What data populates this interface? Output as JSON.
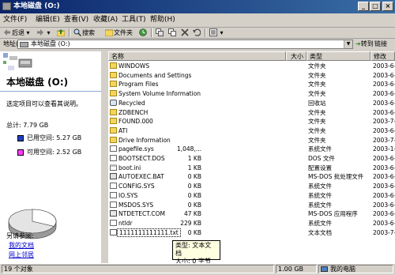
{
  "window": {
    "title": "本地磁盘 (O:)",
    "min": "_",
    "max": "□",
    "close": "×"
  },
  "menu": [
    "文件(F)",
    "编辑(E)",
    "查看(V)",
    "收藏(A)",
    "工具(T)",
    "帮助(H)"
  ],
  "toolbar": {
    "back": "后退",
    "search": "搜索",
    "folders": "文件夹"
  },
  "address": {
    "label": "地址(D)",
    "value": "本地磁盘 (O:)",
    "go": "转到",
    "links": "链接"
  },
  "left": {
    "title": "本地磁盘 (O:)",
    "hint": "选定项目可以查看其说明。",
    "total": "总计: 7.79 GB",
    "used": "已用空间: 5.27 GB",
    "free": "可用空间: 2.52 GB",
    "see_also": "另请参阅:",
    "link1": "我的文档",
    "link2": "网上邻居",
    "used_fraction": 0.68
  },
  "columns": {
    "name": "名称",
    "size": "大小",
    "type": "类型",
    "date": "修改"
  },
  "files": [
    {
      "name": "WINDOWS",
      "size": "",
      "type": "文件夹",
      "date": "2003-6-",
      "icon": "folder-icon"
    },
    {
      "name": "Documents and Settings",
      "size": "",
      "type": "文件夹",
      "date": "2003-6-",
      "icon": "folder-icon"
    },
    {
      "name": "Program Files",
      "size": "",
      "type": "文件夹",
      "date": "2003-6-",
      "icon": "folder-icon"
    },
    {
      "name": "System Volume Information",
      "size": "",
      "type": "文件夹",
      "date": "2003-6-",
      "icon": "folder-icon"
    },
    {
      "name": "Recycled",
      "size": "",
      "type": "回收站",
      "date": "2003-6-",
      "icon": "recycle-icon"
    },
    {
      "name": "ZDBENCH",
      "size": "",
      "type": "文件夹",
      "date": "2003-6-",
      "icon": "folder-icon"
    },
    {
      "name": "FOUND.000",
      "size": "",
      "type": "文件夹",
      "date": "2003-7-",
      "icon": "folder-icon"
    },
    {
      "name": "ATI",
      "size": "",
      "type": "文件夹",
      "date": "2003-6-",
      "icon": "folder-icon"
    },
    {
      "name": "Drive Information",
      "size": "",
      "type": "文件夹",
      "date": "2003-7-",
      "icon": "folder-icon"
    },
    {
      "name": "pagefile.sys",
      "size": "1,048,...",
      "type": "系统文件",
      "date": "2003-1-",
      "icon": "sysfile-icon"
    },
    {
      "name": "BOOTSECT.DOS",
      "size": "1 KB",
      "type": "DOS 文件",
      "date": "2003-6-",
      "icon": "file-icon"
    },
    {
      "name": "boot.ini",
      "size": "1 KB",
      "type": "配置设置",
      "date": "2003-6-",
      "icon": "ini-icon"
    },
    {
      "name": "AUTOEXEC.BAT",
      "size": "0 KB",
      "type": "MS-DOS 批处理文件",
      "date": "2003-6-",
      "icon": "bat-icon"
    },
    {
      "name": "CONFIG.SYS",
      "size": "0 KB",
      "type": "系统文件",
      "date": "2003-6-",
      "icon": "sysfile-icon"
    },
    {
      "name": "IO.SYS",
      "size": "0 KB",
      "type": "系统文件",
      "date": "2003-6-",
      "icon": "sysfile-icon"
    },
    {
      "name": "MSDOS.SYS",
      "size": "0 KB",
      "type": "系统文件",
      "date": "2003-6-",
      "icon": "sysfile-icon"
    },
    {
      "name": "NTDETECT.COM",
      "size": "47 KB",
      "type": "MS-DOS 应用程序",
      "date": "2003-6-",
      "icon": "com-icon"
    },
    {
      "name": "ntldr",
      "size": "229 KB",
      "type": "系统文件",
      "date": "2003-6-",
      "icon": "sysfile-icon"
    },
    {
      "name": "1111111111111.txt",
      "size": "0 KB",
      "type": "文本文档",
      "date": "2003-7-",
      "icon": "txt-icon",
      "selected": true
    }
  ],
  "tooltip": {
    "line1": "类型: 文本文档",
    "line2": "大小: 0 字节"
  },
  "status": {
    "count": "19 个对象",
    "size": "1.00 GB",
    "location": "我的电脑"
  }
}
